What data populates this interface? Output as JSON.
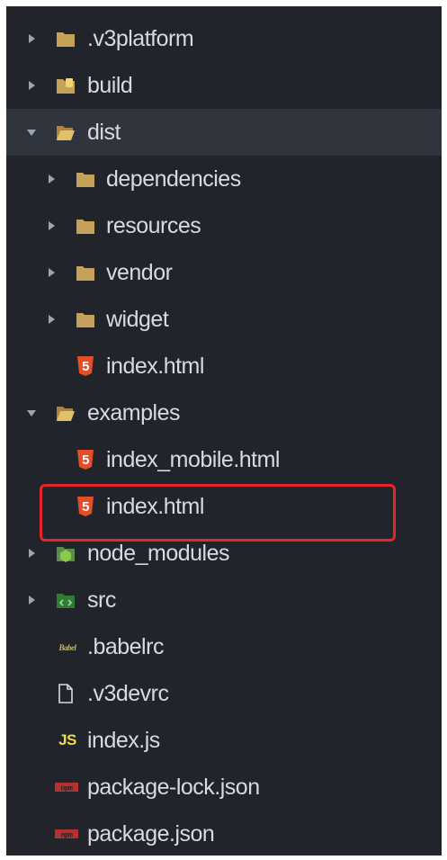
{
  "tree": {
    "items": [
      {
        "label": ".v3platform",
        "type": "folder",
        "state": "collapsed",
        "icon": "folder-icon"
      },
      {
        "label": "build",
        "type": "folder",
        "state": "collapsed",
        "icon": "folder-build-icon"
      },
      {
        "label": "dist",
        "type": "folder",
        "state": "expanded",
        "icon": "folder-open-icon"
      },
      {
        "label": "dependencies",
        "type": "folder",
        "state": "collapsed",
        "icon": "folder-icon"
      },
      {
        "label": "resources",
        "type": "folder",
        "state": "collapsed",
        "icon": "folder-icon"
      },
      {
        "label": "vendor",
        "type": "folder",
        "state": "collapsed",
        "icon": "folder-icon"
      },
      {
        "label": "widget",
        "type": "folder",
        "state": "collapsed",
        "icon": "folder-icon"
      },
      {
        "label": "index.html",
        "type": "file",
        "icon": "html5-icon"
      },
      {
        "label": "examples",
        "type": "folder",
        "state": "expanded",
        "icon": "folder-open-icon"
      },
      {
        "label": "index_mobile.html",
        "type": "file",
        "icon": "html5-icon"
      },
      {
        "label": "index.html",
        "type": "file",
        "icon": "html5-icon",
        "highlighted": true
      },
      {
        "label": "node_modules",
        "type": "folder",
        "state": "collapsed",
        "icon": "node-folder-icon"
      },
      {
        "label": "src",
        "type": "folder",
        "state": "collapsed",
        "icon": "src-folder-icon"
      },
      {
        "label": ".babelrc",
        "type": "file",
        "icon": "babel-icon"
      },
      {
        "label": ".v3devrc",
        "type": "file",
        "icon": "file-icon"
      },
      {
        "label": "index.js",
        "type": "file",
        "icon": "js-icon",
        "icon_text": "JS"
      },
      {
        "label": "package-lock.json",
        "type": "file",
        "icon": "npm-icon"
      },
      {
        "label": "package.json",
        "type": "file",
        "icon": "npm-icon"
      }
    ],
    "babel_icon_text": "Babel",
    "html5_glyph": "5",
    "npm_icon_text": "npm"
  },
  "colors": {
    "background": "#21252b",
    "selected_row": "#2f343d",
    "text": "#d7dae0",
    "folder": "#c5a15a",
    "html5": "#e44d26",
    "js": "#f0db4f",
    "highlight_border": "#e42628"
  }
}
